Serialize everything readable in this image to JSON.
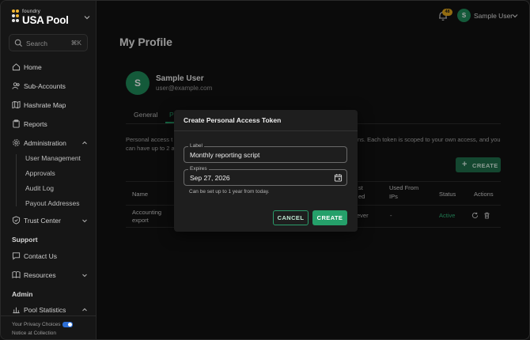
{
  "brand": {
    "small": "foundry",
    "name": "USA Pool"
  },
  "search": {
    "placeholder": "Search",
    "shortcut": "⌘K"
  },
  "sidebar": {
    "home": "Home",
    "sub_accounts": "Sub-Accounts",
    "hashrate_map": "Hashrate Map",
    "reports": "Reports",
    "administration": "Administration",
    "admin_sub": [
      "User Management",
      "Approvals",
      "Audit Log",
      "Payout Addresses"
    ],
    "trust_center": "Trust Center",
    "support_heading": "Support",
    "contact_us": "Contact Us",
    "resources": "Resources",
    "admin_heading": "Admin",
    "pool_statistics": "Pool Statistics",
    "privacy_line1": "Your Privacy Choices",
    "privacy_line2": "Notice at Collection"
  },
  "header": {
    "notification_count": "48",
    "user_initial": "S",
    "user_name": "Sample User"
  },
  "page": {
    "title": "My Profile"
  },
  "profile": {
    "initial": "S",
    "name": "Sample User",
    "email": "user@example.com"
  },
  "tabs": [
    "General",
    "P"
  ],
  "description": {
    "left_line1": "Personal access t",
    "left_line2": "can have up to 2 a",
    "right_line1": "ns. Each token is scoped to your own access, and you"
  },
  "create_button": "CREATE",
  "table": {
    "headers": {
      "name": "Name",
      "last_used_1": "st",
      "last_used_2": "ed",
      "used_from_1": "Used From",
      "used_from_2": "IPs",
      "status": "Status",
      "actions": "Actions"
    },
    "rows": [
      {
        "name_line1": "Accounting",
        "name_line2": "export",
        "last_used": "ever",
        "used_from": "-",
        "status": "Active"
      }
    ]
  },
  "dialog": {
    "title": "Create Personal Access Token",
    "label_legend": "Label",
    "label_value": "Monthly reporting script",
    "expires_legend": "Expires",
    "expires_value": "Sep 27, 2026",
    "helper": "Can be set up to 1 year from today.",
    "cancel": "CANCEL",
    "create": "CREATE"
  },
  "colors": {
    "accent": "#25a06a",
    "badge": "#e0a71b",
    "background": "#121212"
  }
}
